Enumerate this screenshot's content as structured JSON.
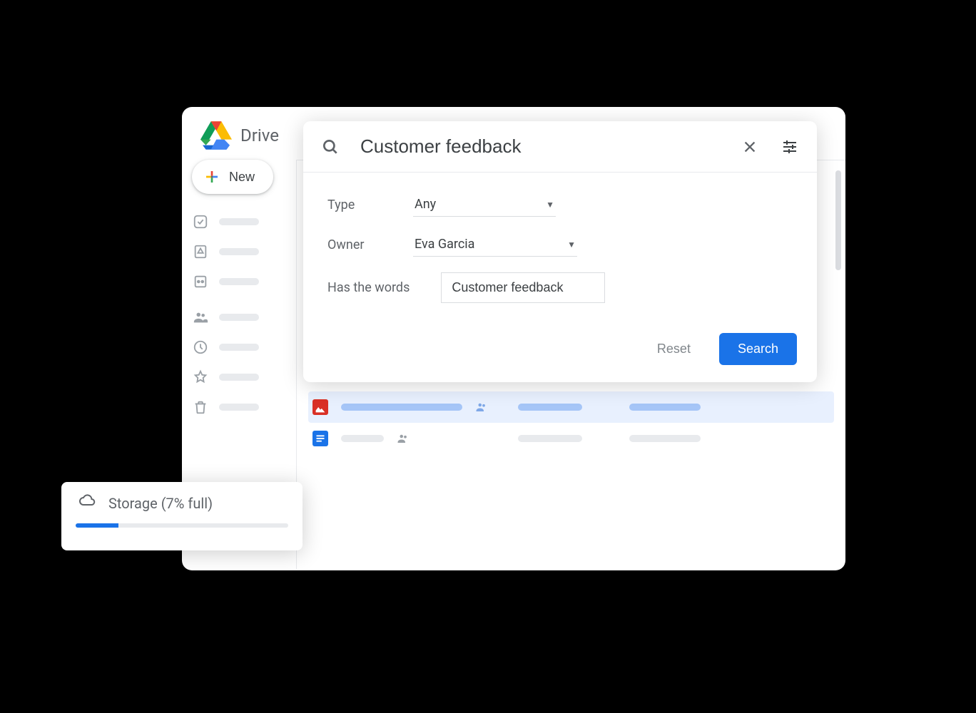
{
  "app": {
    "title": "Drive"
  },
  "new_button": {
    "label": "New"
  },
  "search": {
    "query": "Customer feedback",
    "filters": {
      "type_label": "Type",
      "type_value": "Any",
      "owner_label": "Owner",
      "owner_value": "Eva Garcia",
      "words_label": "Has the words",
      "words_value": "Customer feedback"
    },
    "reset_label": "Reset",
    "search_label": "Search"
  },
  "storage": {
    "label": "Storage (7% full)",
    "percent": 7
  },
  "colors": {
    "accent": "#1a73e8",
    "folder": "#5f6368",
    "image": "#d93025",
    "doc": "#1a73e8"
  }
}
